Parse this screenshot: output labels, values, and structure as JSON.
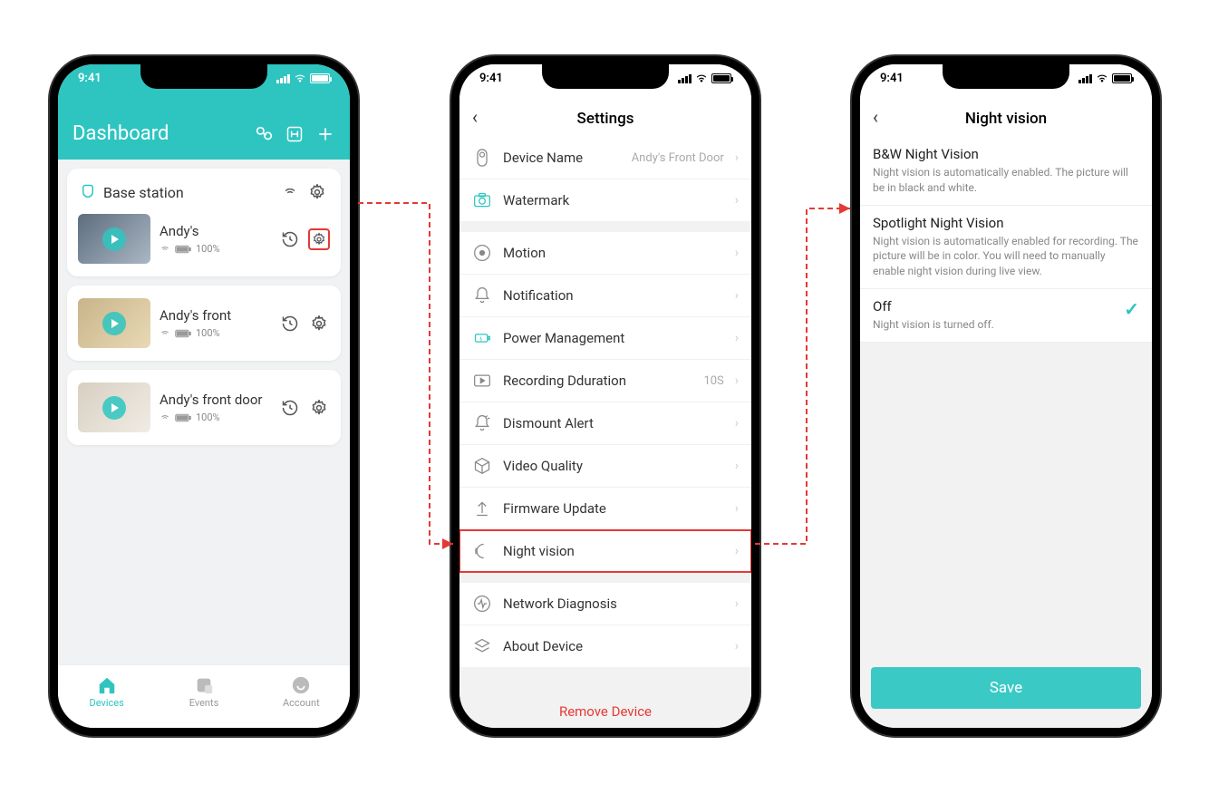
{
  "status": {
    "time": "9:41"
  },
  "phone1": {
    "title": "Dashboard",
    "base_station": "Base station",
    "devices": [
      {
        "name": "Andy's",
        "battery": "100%"
      },
      {
        "name": "Andy's front",
        "battery": "100%"
      },
      {
        "name": "Andy's front door",
        "battery": "100%"
      }
    ],
    "tabs": {
      "devices": "Devices",
      "events": "Events",
      "account": "Account"
    }
  },
  "phone2": {
    "title": "Settings",
    "rows": {
      "device_name": {
        "label": "Device Name",
        "value": "Andy's Front Door"
      },
      "watermark": {
        "label": "Watermark"
      },
      "motion": {
        "label": "Motion"
      },
      "notification": {
        "label": "Notification"
      },
      "power": {
        "label": "Power Management"
      },
      "recording": {
        "label": "Recording Dduration",
        "value": "10S"
      },
      "dismount": {
        "label": "Dismount Alert"
      },
      "video_quality": {
        "label": "Video Quality"
      },
      "firmware": {
        "label": "Firmware Update"
      },
      "night_vision": {
        "label": "Night vision"
      },
      "network": {
        "label": "Network Diagnosis"
      },
      "about": {
        "label": "About Device"
      }
    },
    "remove": "Remove Device"
  },
  "phone3": {
    "title": "Night vision",
    "options": {
      "bw": {
        "title": "B&W Night Vision",
        "desc": "Night vision is automatically enabled. The picture will be in black and white."
      },
      "spotlight": {
        "title": "Spotlight Night Vision",
        "desc": "Night vision is automatically enabled for recording. The picture will be in color. You will need to manually enable night vision during live view."
      },
      "off": {
        "title": "Off",
        "desc": "Night vision is turned off."
      }
    },
    "save": "Save"
  }
}
